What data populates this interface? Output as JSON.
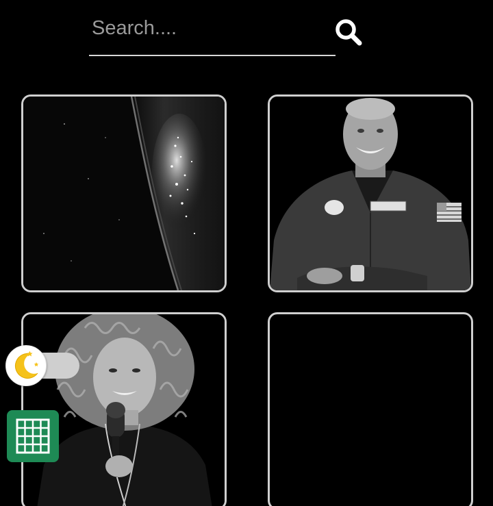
{
  "search": {
    "placeholder": "Search....",
    "value": "",
    "button_icon": "search-icon"
  },
  "cards": [
    {
      "image": "earth-from-orbit-photo"
    },
    {
      "image": "astronaut-portrait-photo"
    },
    {
      "image": "woman-with-microphone-photo"
    },
    {
      "image": "empty"
    }
  ],
  "theme_toggle": {
    "icon": "moon-stars-icon",
    "state": "dark"
  },
  "grid_button": {
    "icon": "spreadsheet-grid-icon"
  },
  "colors": {
    "background": "#000000",
    "card_border": "#cfcfcf",
    "search_underline": "#d8d8d8",
    "placeholder": "#9a9a9a",
    "grid_button": "#1e8a55",
    "moon": "#f5c21b",
    "toggle_track": "#cfcfcf"
  }
}
